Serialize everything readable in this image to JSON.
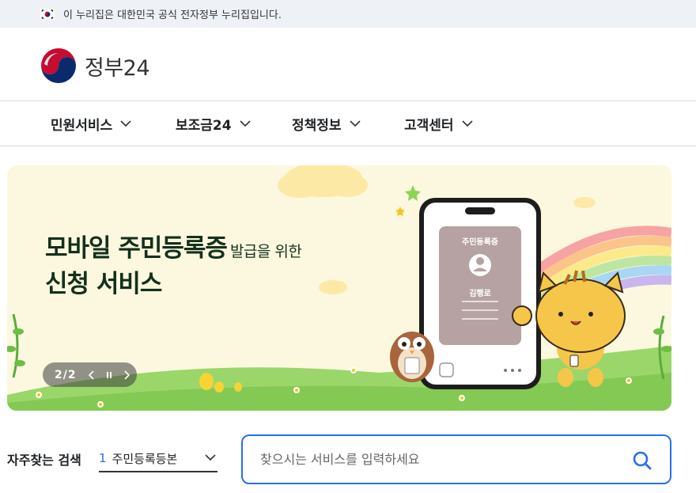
{
  "gov_banner": {
    "text": "이 누리집은 대한민국 공식 전자정부 누리집입니다."
  },
  "logo": {
    "text": "정부24"
  },
  "nav": {
    "items": [
      {
        "label": "민원서비스"
      },
      {
        "label": "보조금24"
      },
      {
        "label": "정책정보"
      },
      {
        "label": "고객센터"
      }
    ]
  },
  "hero": {
    "title_main": "모바일 주민등록증",
    "title_sub": "발급을 위한",
    "title_line2": "신청 서비스",
    "card_title": "주민등록증",
    "card_name": "김행로",
    "slide_counter": "2/2"
  },
  "search": {
    "label": "자주찾는 검색",
    "favorite_num": "1",
    "favorite_text": "주민등록등본",
    "placeholder": "찾으시는 서비스를 입력하세요"
  },
  "colors": {
    "accent": "#256ef4",
    "hero_bg": "#fbf8df",
    "hero_text": "#14301c",
    "banner_bg": "#eef2f7"
  }
}
